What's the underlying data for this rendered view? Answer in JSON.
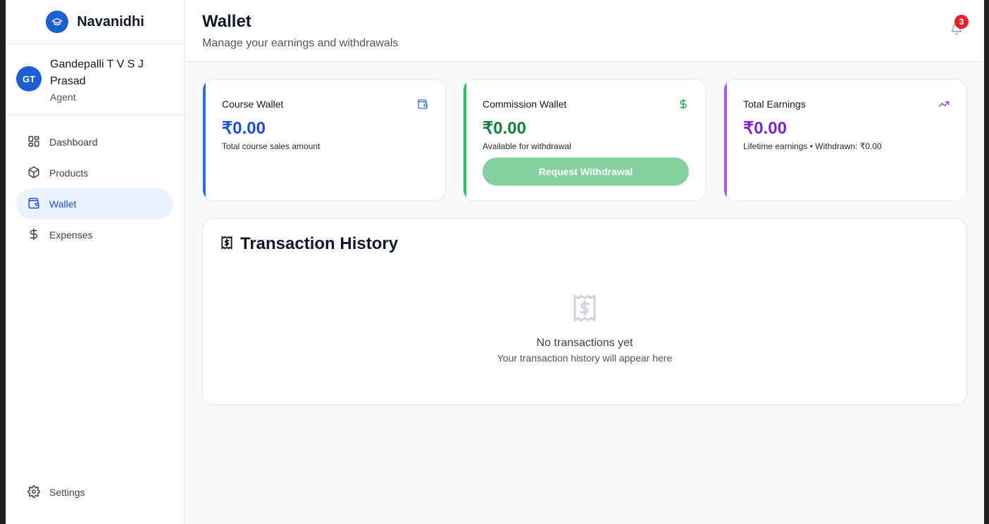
{
  "brand": {
    "name": "Navanidhi",
    "logo_icon": "graduation-cap-icon"
  },
  "user": {
    "initials": "GT",
    "name": "Gandepalli T V S J Prasad",
    "role": "Agent"
  },
  "nav": {
    "items": [
      {
        "label": "Dashboard",
        "icon": "dashboard-grid-icon",
        "active": false
      },
      {
        "label": "Products",
        "icon": "package-icon",
        "active": false
      },
      {
        "label": "Wallet",
        "icon": "wallet-icon",
        "active": true
      },
      {
        "label": "Expenses",
        "icon": "dollar-sign-icon",
        "active": false
      }
    ],
    "settings_label": "Settings"
  },
  "header": {
    "title": "Wallet",
    "subtitle": "Manage your earnings and withdrawals",
    "notification_count": "3"
  },
  "cards": {
    "course": {
      "label": "Course Wallet",
      "value": "₹0.00",
      "desc": "Total course sales amount",
      "accent": "#2f6fdd",
      "value_color": "#1d4ed8"
    },
    "commission": {
      "label": "Commission Wallet",
      "value": "₹0.00",
      "desc": "Available for withdrawal",
      "button_label": "Request Withdrawal",
      "accent": "#22c55e",
      "value_color": "#15803d"
    },
    "earnings": {
      "label": "Total Earnings",
      "value": "₹0.00",
      "desc": "Lifetime earnings • Withdrawn: ₹0.00",
      "accent": "#a855f7",
      "value_color": "#7e22ce"
    }
  },
  "history": {
    "title": "Transaction History",
    "empty_title": "No transactions yet",
    "empty_subtitle": "Your transaction history will appear here"
  }
}
